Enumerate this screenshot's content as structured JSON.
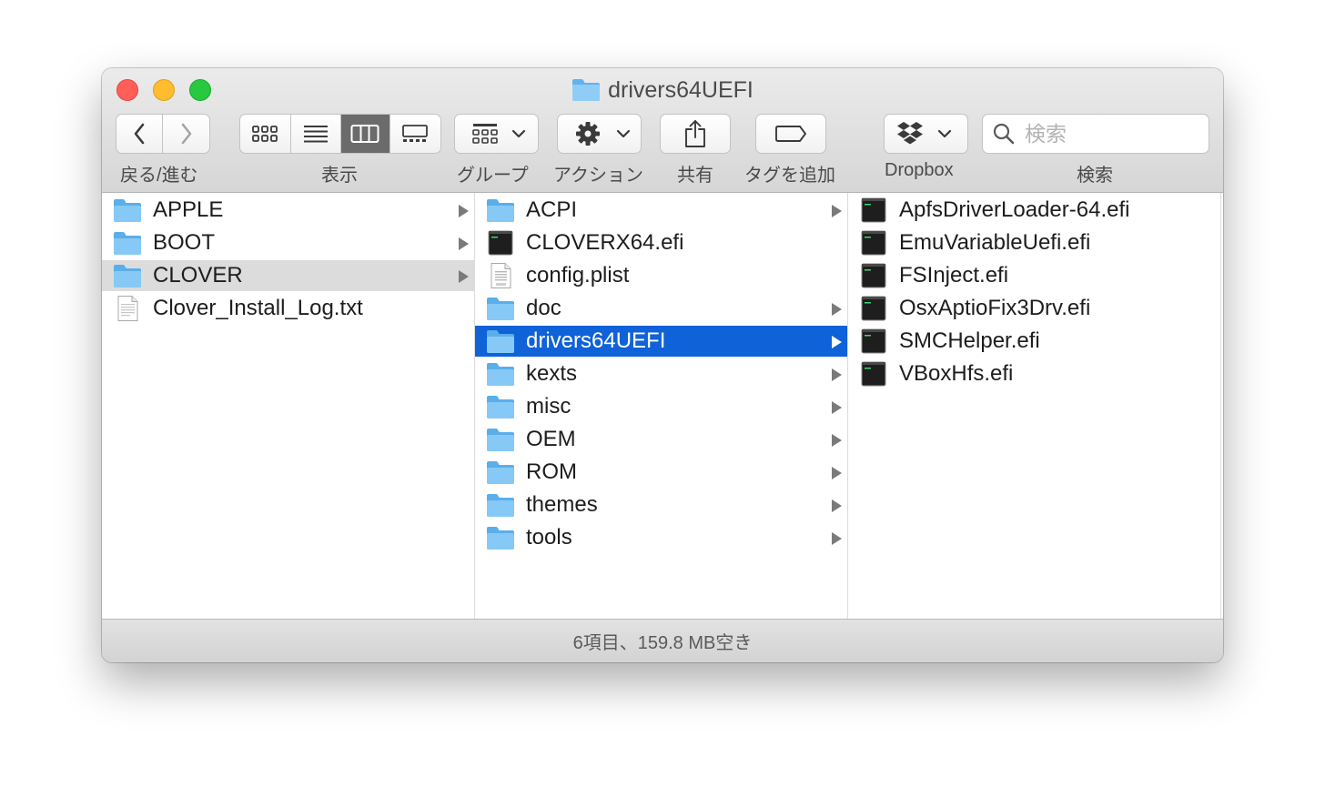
{
  "window": {
    "title": "drivers64UEFI"
  },
  "toolbar": {
    "back_forward_label": "戻る/進む",
    "view_label": "表示",
    "group_label": "グループ",
    "action_label": "アクション",
    "share_label": "共有",
    "tag_label": "タグを追加",
    "dropbox_label": "Dropbox",
    "search_label": "検索",
    "search_placeholder": "検索",
    "active_view": "columns"
  },
  "columns": [
    {
      "items": [
        {
          "name": "APPLE",
          "kind": "folder",
          "has_children": true
        },
        {
          "name": "BOOT",
          "kind": "folder",
          "has_children": true
        },
        {
          "name": "CLOVER",
          "kind": "folder",
          "has_children": true,
          "selected": "inactive"
        },
        {
          "name": "Clover_Install_Log.txt",
          "kind": "text-file",
          "has_children": false
        }
      ]
    },
    {
      "items": [
        {
          "name": "ACPI",
          "kind": "folder",
          "has_children": true
        },
        {
          "name": "CLOVERX64.efi",
          "kind": "exec",
          "has_children": false
        },
        {
          "name": "config.plist",
          "kind": "plist",
          "has_children": false
        },
        {
          "name": "doc",
          "kind": "folder",
          "has_children": true
        },
        {
          "name": "drivers64UEFI",
          "kind": "folder",
          "has_children": true,
          "selected": "active"
        },
        {
          "name": "kexts",
          "kind": "folder",
          "has_children": true
        },
        {
          "name": "misc",
          "kind": "folder",
          "has_children": true
        },
        {
          "name": "OEM",
          "kind": "folder",
          "has_children": true
        },
        {
          "name": "ROM",
          "kind": "folder",
          "has_children": true
        },
        {
          "name": "themes",
          "kind": "folder",
          "has_children": true
        },
        {
          "name": "tools",
          "kind": "folder",
          "has_children": true
        }
      ]
    },
    {
      "items": [
        {
          "name": "ApfsDriverLoader-64.efi",
          "kind": "exec",
          "has_children": false
        },
        {
          "name": "EmuVariableUefi.efi",
          "kind": "exec",
          "has_children": false
        },
        {
          "name": "FSInject.efi",
          "kind": "exec",
          "has_children": false
        },
        {
          "name": "OsxAptioFix3Drv.efi",
          "kind": "exec",
          "has_children": false
        },
        {
          "name": "SMCHelper.efi",
          "kind": "exec",
          "has_children": false
        },
        {
          "name": "VBoxHfs.efi",
          "kind": "exec",
          "has_children": false
        }
      ]
    }
  ],
  "status": {
    "text": "6項目、159.8 MB空き"
  },
  "colors": {
    "selection_active": "#0f62d8",
    "selection_inactive": "#dcdcdc",
    "folder_blue": "#78c1f3",
    "close": "#ff5f57",
    "minimize": "#febc2e",
    "zoom": "#28c840"
  }
}
